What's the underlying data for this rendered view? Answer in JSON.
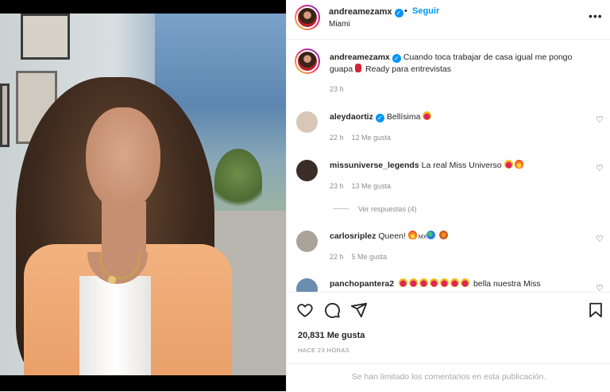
{
  "post": {
    "author": "andreamezamx",
    "verified": true,
    "separator": "•",
    "follow_label": "Seguir",
    "location": "Miami",
    "more_label": "•••"
  },
  "caption": {
    "username": "andreamezamx",
    "text": "Cuando toca trabajar de casa igual me pongo guapa",
    "text_after_emoji": "Ready para entrevistas",
    "time": "23 h"
  },
  "comments": [
    {
      "username": "aleydaortiz",
      "verified": true,
      "text": "Bellísima",
      "emojis": [
        "heart-eyes-emoji"
      ],
      "time": "22 h",
      "likes": "12 Me gusta",
      "avatar_color": "#d8c7b6"
    },
    {
      "username": "missuniverse_legends",
      "verified": false,
      "text": "La real Miss Universo",
      "emojis": [
        "heart-eyes-emoji",
        "fire-emoji"
      ],
      "time": "23 h",
      "likes": "13 Me gusta",
      "avatar_color": "#3a2c27"
    },
    {
      "username": "carlosriplez",
      "verified": false,
      "text": "Queen!",
      "emojis": [
        "fire-emoji",
        "mx-flag-emoji",
        "globe-emoji",
        "planet-emoji"
      ],
      "time": "22 h",
      "likes": "5 Me gusta",
      "avatar_color": "#a9a39a"
    },
    {
      "username": "panchopantera2",
      "verified": false,
      "text": "bella nuestra Miss",
      "emojis": [
        "heart-eyes-emoji",
        "heart-eyes-emoji",
        "heart-eyes-emoji",
        "heart-eyes-emoji",
        "heart-eyes-emoji",
        "heart-eyes-emoji",
        "heart-eyes-emoji"
      ],
      "time": "",
      "likes": "",
      "avatar_color": "#6a8db0"
    }
  ],
  "flag_text": "MX",
  "view_replies": "Ver respuestas (4)",
  "actions": {
    "like_icon": "heart-outline-icon",
    "comment_icon": "comment-bubble-icon",
    "share_icon": "paper-plane-icon",
    "save_icon": "bookmark-icon"
  },
  "likes_label": "20,831 Me gusta",
  "posted_ago": "HACE 23 HORAS",
  "comments_limited": "Se han limitado los comentarios en esta publicación.",
  "colors": {
    "link_blue": "#0095f6",
    "text": "#262626",
    "muted": "#8e8e8e",
    "blazer": "#ea9f68"
  }
}
